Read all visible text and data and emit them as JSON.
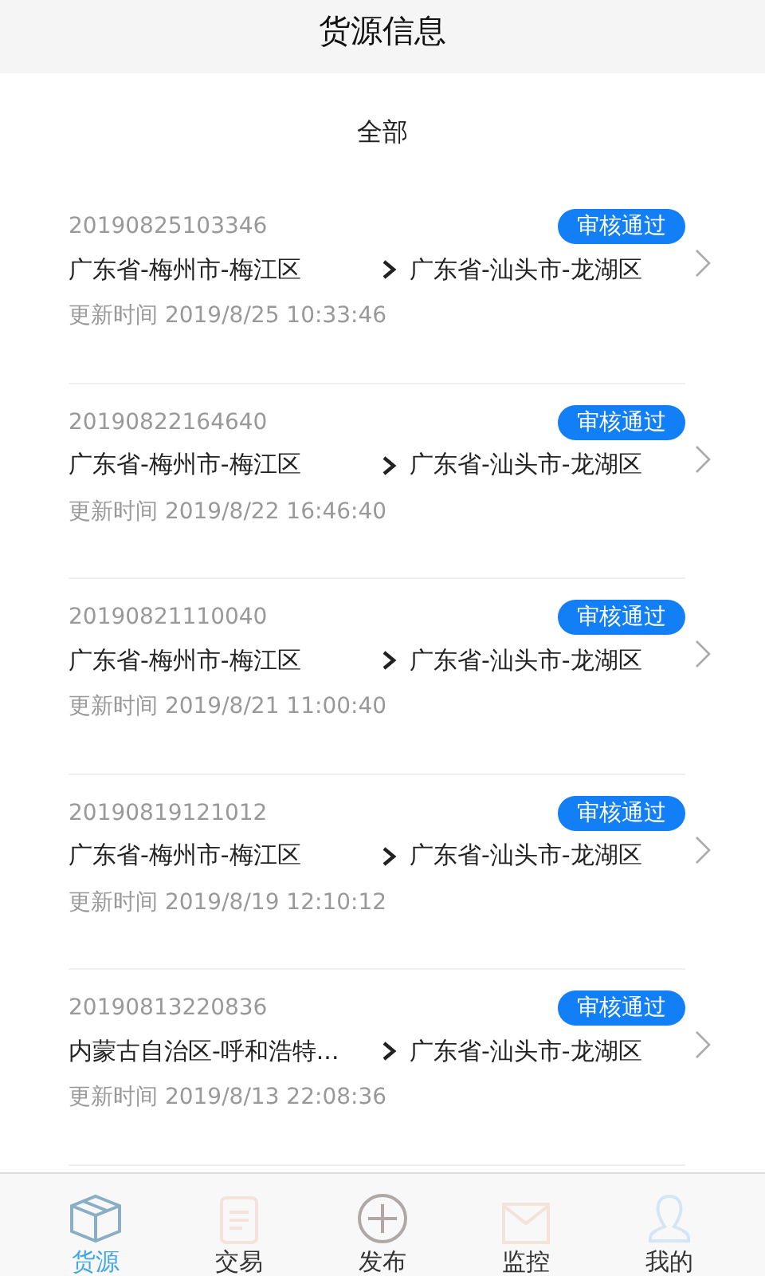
{
  "header": {
    "title": "货源信息"
  },
  "filter": {
    "label": "全部"
  },
  "orders": [
    {
      "number": "20190825103346",
      "status": "审核通过",
      "from": "广东省-梅州市-梅江区",
      "to": "广东省-汕头市-龙湖区",
      "updated": "更新时间 2019/8/25 10:33:46"
    },
    {
      "number": "20190822164640",
      "status": "审核通过",
      "from": "广东省-梅州市-梅江区",
      "to": "广东省-汕头市-龙湖区",
      "updated": "更新时间 2019/8/22 16:46:40"
    },
    {
      "number": "20190821110040",
      "status": "审核通过",
      "from": "广东省-梅州市-梅江区",
      "to": "广东省-汕头市-龙湖区",
      "updated": "更新时间 2019/8/21 11:00:40"
    },
    {
      "number": "20190819121012",
      "status": "审核通过",
      "from": "广东省-梅州市-梅江区",
      "to": "广东省-汕头市-龙湖区",
      "updated": "更新时间 2019/8/19 12:10:12"
    },
    {
      "number": "20190813220836",
      "status": "审核通过",
      "from": "内蒙古自治区-呼和浩特...",
      "to": "广东省-汕头市-龙湖区",
      "updated": "更新时间 2019/8/13 22:08:36"
    }
  ],
  "tabs": [
    {
      "label": "货源",
      "kind": "box",
      "selected": true
    },
    {
      "label": "交易",
      "kind": "document",
      "selected": false
    },
    {
      "label": "发布",
      "kind": "plus",
      "selected": false
    },
    {
      "label": "监控",
      "kind": "mail",
      "selected": false
    },
    {
      "label": "我的",
      "kind": "person",
      "selected": false
    }
  ]
}
